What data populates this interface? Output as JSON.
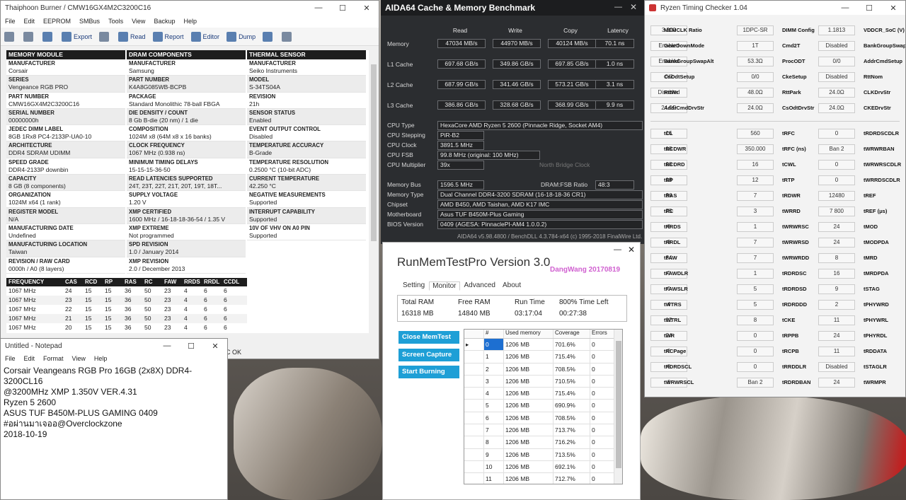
{
  "thaiphoon": {
    "title": "Thaiphoon Burner / CMW16GX4M2C3200C16",
    "menu": [
      "File",
      "Edit",
      "EEPROM",
      "SMBus",
      "Tools",
      "View",
      "Backup",
      "Help"
    ],
    "toolbar": [
      "Export",
      "Read",
      "Report",
      "Editor",
      "Dump"
    ],
    "status": "C OK",
    "col1": [
      [
        "MEMORY MODULE",
        ""
      ],
      [
        "MANUFACTURER",
        "Corsair"
      ],
      [
        "SERIES",
        "Vengeance RGB PRO"
      ],
      [
        "PART NUMBER",
        "CMW16GX4M2C3200C16"
      ],
      [
        "SERIAL NUMBER",
        "00000000h"
      ],
      [
        "JEDEC DIMM LABEL",
        "8GB 1Rx8 PC4-2133P-UA0-10"
      ],
      [
        "ARCHITECTURE",
        "DDR4 SDRAM UDIMM"
      ],
      [
        "SPEED GRADE",
        "DDR4-2133P downbin"
      ],
      [
        "CAPACITY",
        "8 GB (8 components)"
      ],
      [
        "ORGANIZATION",
        "1024M x64 (1 rank)"
      ],
      [
        "REGISTER MODEL",
        "N/A"
      ],
      [
        "MANUFACTURING DATE",
        "Undefined"
      ],
      [
        "MANUFACTURING LOCATION",
        "Taiwan"
      ],
      [
        "REVISION / RAW CARD",
        "0000h / A0 (8 layers)"
      ]
    ],
    "col2": [
      [
        "DRAM COMPONENTS",
        ""
      ],
      [
        "MANUFACTURER",
        "Samsung"
      ],
      [
        "PART NUMBER",
        "K4A8G085WB-BCPB"
      ],
      [
        "PACKAGE",
        "Standard Monolithic 78-ball FBGA"
      ],
      [
        "DIE DENSITY / COUNT",
        "8 Gb B-die (20 nm) / 1 die"
      ],
      [
        "COMPOSITION",
        "1024M x8 (64M x8 x 16 banks)"
      ],
      [
        "CLOCK FREQUENCY",
        "1067 MHz (0.938 ns)"
      ],
      [
        "MINIMUM TIMING DELAYS",
        "15-15-15-36-50"
      ],
      [
        "READ LATENCIES SUPPORTED",
        "24T, 23T, 22T, 21T, 20T, 19T, 18T..."
      ],
      [
        "SUPPLY VOLTAGE",
        "1.20 V"
      ],
      [
        "XMP CERTIFIED",
        "1600 MHz / 16-18-18-36-54 / 1.35 V"
      ],
      [
        "XMP EXTREME",
        "Not programmed"
      ],
      [
        "SPD REVISION",
        "1.0 / January 2014"
      ],
      [
        "XMP REVISION",
        "2.0 / December 2013"
      ]
    ],
    "col3": [
      [
        "THERMAL SENSOR",
        ""
      ],
      [
        "MANUFACTURER",
        "Seiko Instruments"
      ],
      [
        "MODEL",
        "S-34TS04A"
      ],
      [
        "REVISION",
        "21h"
      ],
      [
        "SENSOR STATUS",
        "Enabled"
      ],
      [
        "EVENT OUTPUT CONTROL",
        "Disabled"
      ],
      [
        "TEMPERATURE ACCURACY",
        "B-Grade"
      ],
      [
        "TEMPERATURE RESOLUTION",
        "0.2500 °C (10-bit ADC)"
      ],
      [
        "CURRENT TEMPERATURE",
        "42.250 °C"
      ],
      [
        "NEGATIVE MEASUREMENTS",
        "Supported"
      ],
      [
        "INTERRUPT CAPABILITY",
        "Supported"
      ],
      [
        "10V OF VHV ON A0 PIN",
        "Supported"
      ]
    ],
    "freq_headers": [
      "FREQUENCY",
      "CAS",
      "RCD",
      "RP",
      "RAS",
      "RC",
      "FAW",
      "RRDS",
      "RRDL",
      "CCDL"
    ],
    "freq_rows": [
      [
        "1067 MHz",
        "24",
        "15",
        "15",
        "36",
        "50",
        "23",
        "4",
        "6",
        "6"
      ],
      [
        "1067 MHz",
        "23",
        "15",
        "15",
        "36",
        "50",
        "23",
        "4",
        "6",
        "6"
      ],
      [
        "1067 MHz",
        "22",
        "15",
        "15",
        "36",
        "50",
        "23",
        "4",
        "6",
        "6"
      ],
      [
        "1067 MHz",
        "21",
        "15",
        "15",
        "36",
        "50",
        "23",
        "4",
        "6",
        "6"
      ],
      [
        "1067 MHz",
        "20",
        "15",
        "15",
        "36",
        "50",
        "23",
        "4",
        "6",
        "6"
      ]
    ]
  },
  "notepad": {
    "title": "Untitled - Notepad",
    "menu": [
      "File",
      "Edit",
      "Format",
      "View",
      "Help"
    ],
    "lines": [
      "Corsair Veangeans RGB Pro 16GB (2x8X) DDR4-3200CL16",
      "@3200MHz XMP 1.350V   VER.4.31",
      "Ryzen 5 2600",
      "ASUS TUF B450M-PLUS GAMING 0409",
      "#อผ่านมาเจออ@Overclockzone",
      "2018-10-19"
    ]
  },
  "aida": {
    "title": "AIDA64 Cache & Memory Benchmark",
    "cols": [
      "Read",
      "Write",
      "Copy",
      "Latency"
    ],
    "rows": [
      {
        "label": "Memory",
        "vals": [
          "47034 MB/s",
          "44970 MB/s",
          "40124 MB/s",
          "70.1 ns"
        ]
      },
      {
        "label": "L1 Cache",
        "vals": [
          "697.68 GB/s",
          "349.86 GB/s",
          "697.85 GB/s",
          "1.0 ns"
        ]
      },
      {
        "label": "L2 Cache",
        "vals": [
          "687.99 GB/s",
          "341.46 GB/s",
          "573.21 GB/s",
          "3.1 ns"
        ]
      },
      {
        "label": "L3 Cache",
        "vals": [
          "386.86 GB/s",
          "328.68 GB/s",
          "368.99 GB/s",
          "9.9 ns"
        ]
      }
    ],
    "cpu_type_l": "CPU Type",
    "cpu_type": "HexaCore AMD Ryzen 5 2600  (Pinnacle Ridge, Socket AM4)",
    "cpu_step_l": "CPU Stepping",
    "cpu_step": "PiR-B2",
    "cpu_clock_l": "CPU Clock",
    "cpu_clock": "3891.5 MHz",
    "cpu_fsb_l": "CPU FSB",
    "cpu_fsb": "99.8 MHz  (original: 100 MHz)",
    "cpu_mult_l": "CPU Multiplier",
    "cpu_mult": "39x",
    "nb_clock": "North Bridge Clock",
    "mem_bus_l": "Memory Bus",
    "mem_bus": "1596.5 MHz",
    "dram_fsb_l": "DRAM:FSB Ratio",
    "dram_fsb": "48:3",
    "mem_type_l": "Memory Type",
    "mem_type": "Dual Channel DDR4-3200 SDRAM  (16-18-18-36 CR1)",
    "chipset_l": "Chipset",
    "chipset": "AMD B450, AMD Taishan, AMD K17 IMC",
    "mobo_l": "Motherboard",
    "mobo": "Asus TUF B450M-Plus Gaming",
    "bios_l": "BIOS Version",
    "bios": "0409  (AGESA: PinnaclePI-AM4 1.0.0.2)",
    "footer": "AIDA64 v5.98.4800 / BenchDLL 4.3.784-x64  (c) 1995-2018 FinalWire Ltd."
  },
  "runmem": {
    "title": "RunMemTestPro Version 3.0",
    "author": "DangWang  20170819",
    "tabs": [
      "Setting",
      "Monitor",
      "Advanced",
      "About"
    ],
    "total_ram_l": "Total RAM",
    "total_ram": "16318 MB",
    "free_ram_l": "Free RAM",
    "free_ram": "14840 MB",
    "run_time_l": "Run Time",
    "run_time": "03:17:04",
    "time_left_l": "800% Time Left",
    "time_left": "00:27:38",
    "buttons": [
      "Close MemTest",
      "Screen Capture",
      "Start Burning"
    ],
    "grid_headers": [
      "#",
      "Used memory",
      "Coverage",
      "Errors"
    ],
    "grid_rows": [
      [
        "0",
        "1206 MB",
        "701.6%",
        "0"
      ],
      [
        "1",
        "1206 MB",
        "715.4%",
        "0"
      ],
      [
        "2",
        "1206 MB",
        "708.5%",
        "0"
      ],
      [
        "3",
        "1206 MB",
        "710.5%",
        "0"
      ],
      [
        "4",
        "1206 MB",
        "715.4%",
        "0"
      ],
      [
        "5",
        "1206 MB",
        "690.9%",
        "0"
      ],
      [
        "6",
        "1206 MB",
        "708.5%",
        "0"
      ],
      [
        "7",
        "1206 MB",
        "713.7%",
        "0"
      ],
      [
        "8",
        "1206 MB",
        "716.2%",
        "0"
      ],
      [
        "9",
        "1206 MB",
        "713.5%",
        "0"
      ],
      [
        "10",
        "1206 MB",
        "692.1%",
        "0"
      ],
      [
        "11",
        "1206 MB",
        "712.7%",
        "0"
      ]
    ]
  },
  "rtc": {
    "title": "Ryzen Timing Checker 1.04",
    "top": [
      [
        "3 200",
        "MEMCLK Ratio",
        "1DPC-SR",
        "DIMM Config",
        "1.1813",
        "VDDCR_SoC (V)"
      ],
      [
        "Enabled",
        "GearDownMode",
        "1T",
        "Cmd2T",
        "Disabled",
        "BankGroupSwap"
      ],
      [
        "Enabled",
        "BankGroupSwapAlt",
        "53.3Ω",
        "ProcODT",
        "0/0",
        "AddrCmdSetup"
      ],
      [
        "0/0",
        "CsOdtSetup",
        "0/0",
        "CkeSetup",
        "Disabled",
        "RttNom"
      ],
      [
        "Disabled",
        "RttWr",
        "48.0Ω",
        "RttPark",
        "24.0Ω",
        "CLKDrvStr"
      ],
      [
        "24.0Ω",
        "AddrCmdDrvStr",
        "24.0Ω",
        "CsOdtDrvStr",
        "24.0Ω",
        "CKEDrvStr"
      ]
    ],
    "timings": [
      [
        "16",
        "tCL",
        "560",
        "tRFC",
        "0",
        "tRDRDSCDLR"
      ],
      [
        "18",
        "tRCDWR",
        "350.000",
        "tRFC (ns)",
        "Ban 2",
        "tWRWRBAN"
      ],
      [
        "18",
        "tRCDRD",
        "16",
        "tCWL",
        "0",
        "tWRWRSCDLR"
      ],
      [
        "18",
        "tRP",
        "12",
        "tRTP",
        "0",
        "tWRRDSCDLR"
      ],
      [
        "36",
        "tRAS",
        "7",
        "tRDWR",
        "12480",
        "tREF"
      ],
      [
        "75",
        "tRC",
        "3",
        "tWRRD",
        "7 800",
        "tREF (μs)"
      ],
      [
        "6",
        "tRRDS",
        "1",
        "tWRWRSC",
        "24",
        "tMOD"
      ],
      [
        "9",
        "tRRDL",
        "7",
        "tWRWRSD",
        "24",
        "tMODPDA"
      ],
      [
        "34",
        "tFAW",
        "7",
        "tWRWRDD",
        "8",
        "tMRD"
      ],
      [
        "0",
        "tFAWDLR",
        "1",
        "tRDRDSC",
        "16",
        "tMRDPDA"
      ],
      [
        "0",
        "tFAWSLR",
        "5",
        "tRDRDSD",
        "9",
        "tSTAG"
      ],
      [
        "4",
        "tWTRS",
        "5",
        "tRDRDDD",
        "2",
        "tPHYWRD"
      ],
      [
        "12",
        "tWTRL",
        "8",
        "tCKE",
        "11",
        "tPHYWRL"
      ],
      [
        "24",
        "tWR",
        "0",
        "tRPPB",
        "24",
        "tPHYRDL"
      ],
      [
        "0",
        "tRCPage",
        "0",
        "tRCPB",
        "11",
        "tRDDATA"
      ],
      [
        "6",
        "tRDRDSCL",
        "0",
        "tRRDDLR",
        "Disabled",
        "tSTAGLR"
      ],
      [
        "6",
        "tWRWRSCL",
        "Ban 2",
        "tRDRDBAN",
        "24",
        "tWRMPR"
      ]
    ]
  }
}
